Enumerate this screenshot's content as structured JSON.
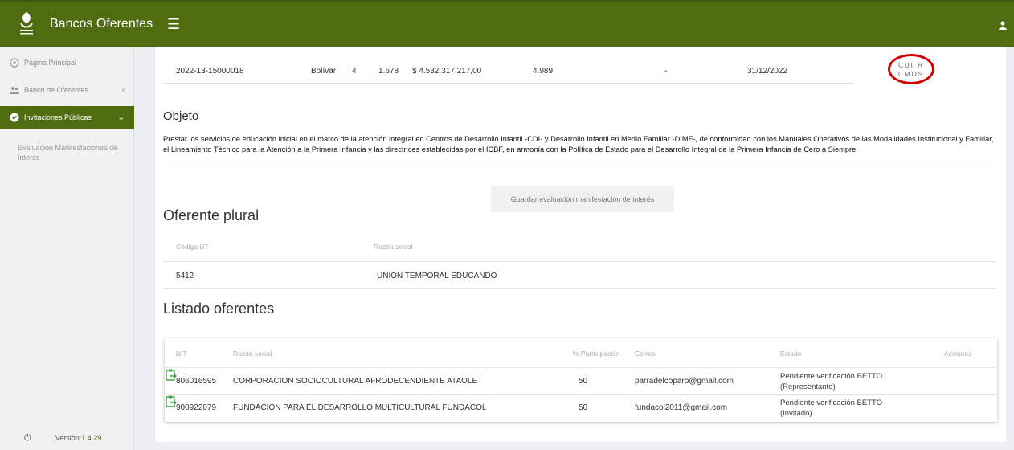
{
  "app": {
    "title": "Bancos Oferentes"
  },
  "icons": {
    "logo": "institution-logo-icon",
    "menu": "hamburger-menu-icon",
    "user": "user-icon",
    "home": "home-icon",
    "bank": "users-icon",
    "invite": "shield-check-icon",
    "power": "power-icon",
    "action": "clipboard-arrow-icon"
  },
  "colors": {
    "topbar": "#4f6c10",
    "active_nav": "#4f6c10",
    "highlight_circle": "#d40000",
    "action_icon": "#43a047"
  },
  "sidebar": {
    "items": [
      {
        "label": "Página Principal"
      },
      {
        "label": "Banco de Oferentes",
        "chevron": "‹"
      },
      {
        "label": "Invitaciones Públicas",
        "chevron": "⌄"
      }
    ],
    "sub_item": "Evaluación Manifestaciones de Interés",
    "version_label": "Versión:",
    "version": "1.4.29"
  },
  "summary": {
    "code": "2022-13-15000018",
    "department": "Bolívar",
    "col3": "4",
    "col4": "1.678",
    "amount": "$ 4.532.317.217,00",
    "col6": "4.989",
    "col7": "-",
    "date": "31/12/2022",
    "circle_line1": "CDI H",
    "circle_line2": "CMOS"
  },
  "objeto": {
    "title": "Objeto",
    "text": "Prestar los servicios de educación inicial en el marco de la atención integral en Centros de Desarrollo Infantil -CDI- y Desarrollo Infantil en Medio Familiar -DIMF-, de conformidad con los Manuales Operativos de las Modalidades Institucional y Familiar, el Lineamiento Técnico para la Atención a la Primera Infancia y las directrices establecidas por el ICBF, en armonía con la Política de Estado para el Desarrollo Integral de la Primera Infancia de Cero a Siempre"
  },
  "save_button": "Guardar evaluación manifestación de interés",
  "oferente_plural": {
    "title": "Oferente plural",
    "headers": {
      "code": "Código UT",
      "name": "Razón social"
    },
    "row": {
      "code": "5412",
      "name": "UNION TEMPORAL EDUCANDO"
    }
  },
  "listado": {
    "title": "Listado oferentes",
    "headers": {
      "nit": "NIT",
      "name": "Razón social",
      "pct": "% Participación",
      "email": "Correo",
      "status": "Estado",
      "actions": "Acciones"
    },
    "rows": [
      {
        "nit": "806016595",
        "name": "CORPORACION SOCIOCULTURAL AFRODECENDIENTE ATAOLE",
        "pct": "50",
        "email": "parradelcoparo@gmail.com",
        "status_1": "Pendiente verificación BETTO",
        "status_2": "(Representante)"
      },
      {
        "nit": "900922079",
        "name": "FUNDACION PARA EL DESARROLLO MULTICULTURAL FUNDACOL",
        "pct": "50",
        "email": "fundacol2011@gmail.com",
        "status_1": "Pendiente verificación BETTO",
        "status_2": "(Invitado)"
      }
    ]
  }
}
